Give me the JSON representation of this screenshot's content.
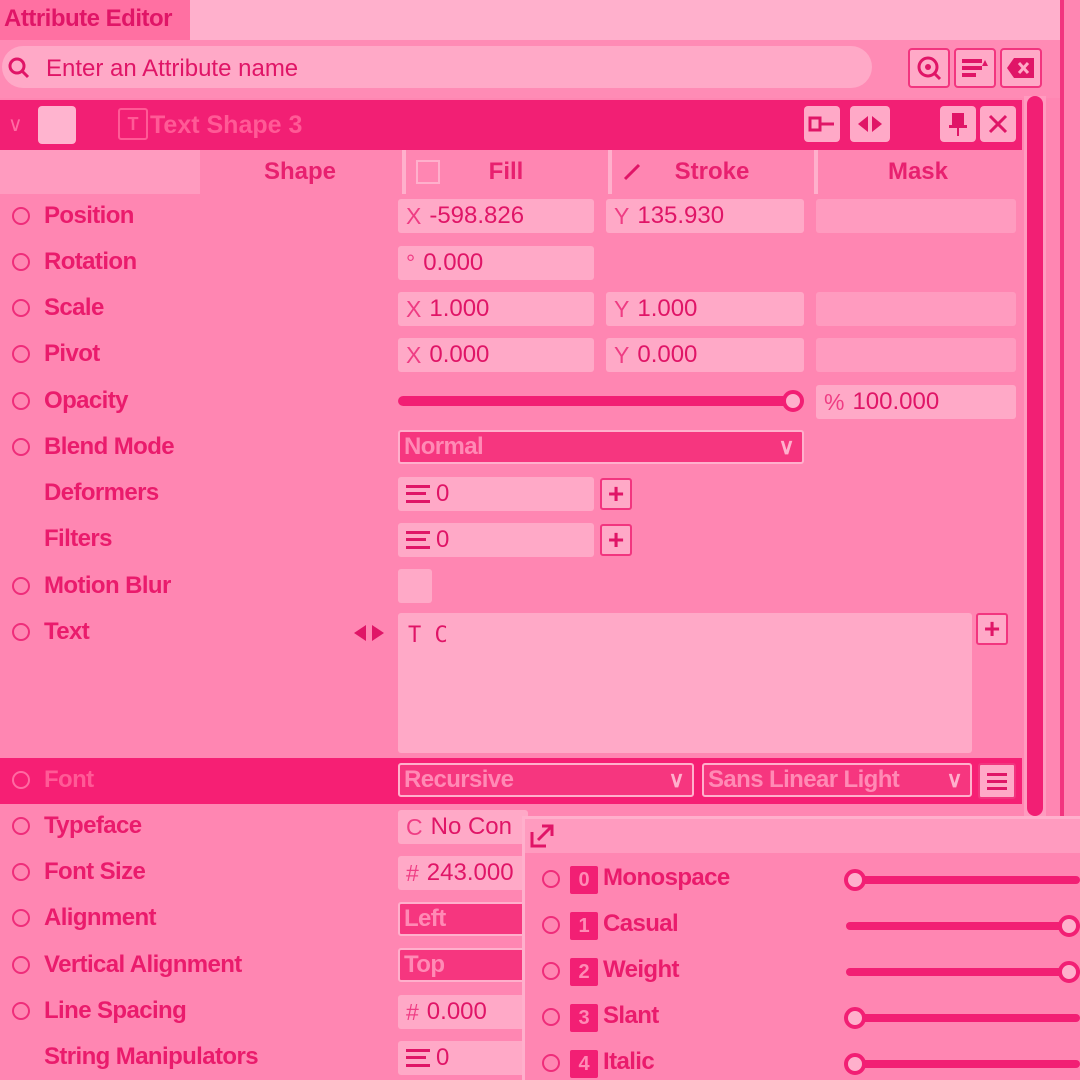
{
  "window": {
    "title": "Attribute Editor"
  },
  "search": {
    "placeholder": "Enter an Attribute name"
  },
  "item": {
    "name": "Text Shape 3",
    "type_icon": "T"
  },
  "tabs": [
    {
      "label": "Shape"
    },
    {
      "label": "Fill"
    },
    {
      "label": "Stroke"
    },
    {
      "label": "Mask"
    }
  ],
  "attributes": {
    "position": {
      "label": "Position",
      "x_prefix": "X",
      "x": "-598.826",
      "y_prefix": "Y",
      "y": "135.930"
    },
    "rotation": {
      "label": "Rotation",
      "prefix": "°",
      "value": "0.000"
    },
    "scale": {
      "label": "Scale",
      "x_prefix": "X",
      "x": "1.000",
      "y_prefix": "Y",
      "y": "1.000"
    },
    "pivot": {
      "label": "Pivot",
      "x_prefix": "X",
      "x": "0.000",
      "y_prefix": "Y",
      "y": "0.000"
    },
    "opacity": {
      "label": "Opacity",
      "prefix": "%",
      "value": "100.000",
      "slider_fraction": 1.0
    },
    "blend_mode": {
      "label": "Blend Mode",
      "value": "Normal"
    },
    "deformers": {
      "label": "Deformers",
      "value": "0"
    },
    "filters": {
      "label": "Filters",
      "value": "0"
    },
    "motion_blur": {
      "label": "Motion Blur"
    },
    "text": {
      "label": "Text",
      "value": "T C"
    },
    "font": {
      "label": "Font",
      "family": "Recursive",
      "style": "Sans Linear Light"
    },
    "typeface": {
      "label": "Typeface",
      "prefix": "C",
      "value": "No Con"
    },
    "font_size": {
      "label": "Font Size",
      "prefix": "#",
      "value": "243.000"
    },
    "alignment": {
      "label": "Alignment",
      "value": "Left"
    },
    "vertical_alignment": {
      "label": "Vertical Alignment",
      "value": "Top"
    },
    "line_spacing": {
      "label": "Line Spacing",
      "prefix": "#",
      "value": "0.000"
    },
    "string_manipulators": {
      "label": "String Manipulators",
      "value": "0"
    }
  },
  "font_axes": [
    {
      "index": "0",
      "label": "Monospace",
      "fraction": 0.0
    },
    {
      "index": "1",
      "label": "Casual",
      "fraction": 1.0
    },
    {
      "index": "2",
      "label": "Weight",
      "fraction": 1.0
    },
    {
      "index": "3",
      "label": "Slant",
      "fraction": 0.0
    },
    {
      "index": "4",
      "label": "Italic",
      "fraction": 0.0
    }
  ],
  "colors": {
    "accent": "#f21f74",
    "background": "#ff86b2",
    "field": "#ffa9c7"
  }
}
